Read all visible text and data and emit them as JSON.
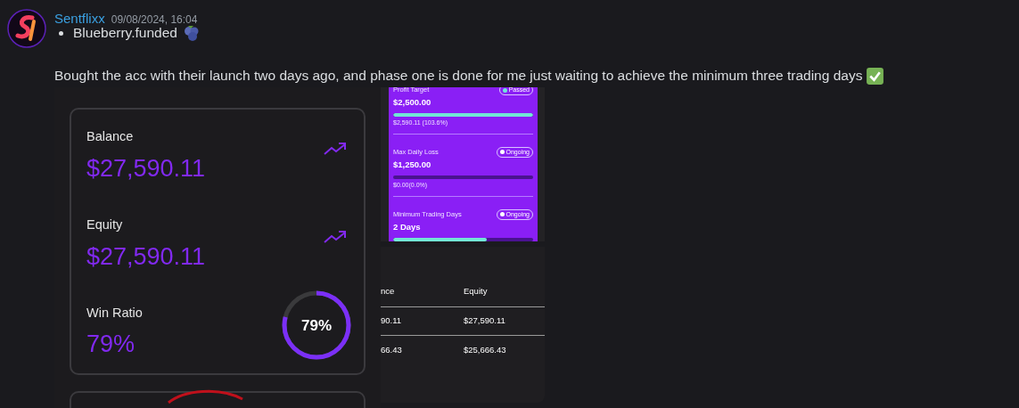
{
  "message": {
    "author": "Sentflixx",
    "timestamp": "09/08/2024, 16:04",
    "bullets": [
      "Blueberry.funded"
    ],
    "text": "Bought the acc with their launch two days ago, and phase one is done for me just waiting to achieve the minimum three trading days"
  },
  "stats_card": {
    "items": [
      {
        "kind": "money",
        "label": "Balance",
        "value": "$27,590.11"
      },
      {
        "kind": "money",
        "label": "Equity",
        "value": "$27,590.11"
      },
      {
        "kind": "ratio",
        "label": "Win Ratio",
        "value": "79%",
        "ring_text": "79%",
        "level": 0.79
      }
    ]
  },
  "objectives": [
    {
      "title": "Profit Target",
      "status": "Passed",
      "color": "#6ee7d8",
      "amount": "$2,500.00",
      "level": 1,
      "detail": "$2,590.11 (103.6%)"
    },
    {
      "title": "Max Daily Loss",
      "status": "Ongoing",
      "color": "#ffffff",
      "amount": "$1,250.00",
      "level": 0,
      "detail": "$0.00(0.0%)"
    },
    {
      "title": "Minimum Trading Days",
      "status": "Ongoing",
      "color": "#ffffff",
      "amount": "2 Days",
      "level": 0.67
    }
  ],
  "table": {
    "columns": [
      "nce",
      "Equity"
    ],
    "rows": [
      [
        "90.11",
        "$27,590.11"
      ],
      [
        "66.43",
        "$25,666.43"
      ]
    ]
  }
}
